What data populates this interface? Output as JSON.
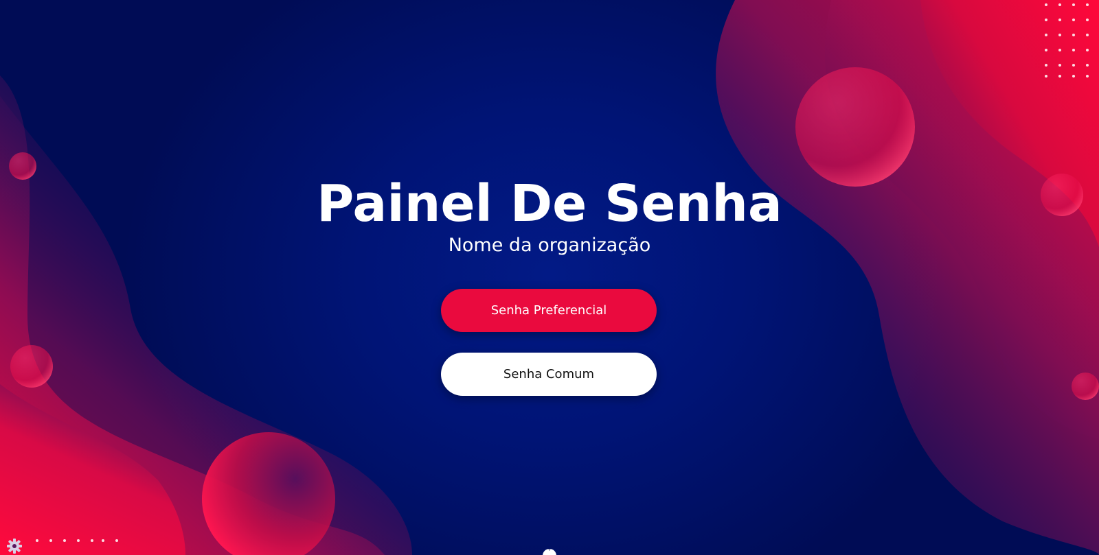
{
  "page": {
    "title": "Painel De Senha",
    "subtitle": "Nome da organização"
  },
  "buttons": {
    "preferencial_label": "Senha Preferencial",
    "comum_label": "Senha Comum"
  },
  "controls": {
    "settings_icon": "gear-icon",
    "bottom_handle_icon": "chevron-down-icon",
    "bottom_handle_glyph": "˅"
  },
  "colors": {
    "background": "#000c55",
    "accent": "#ea0a3e",
    "secondary_button": "#ffffff",
    "text": "#ffffff"
  }
}
